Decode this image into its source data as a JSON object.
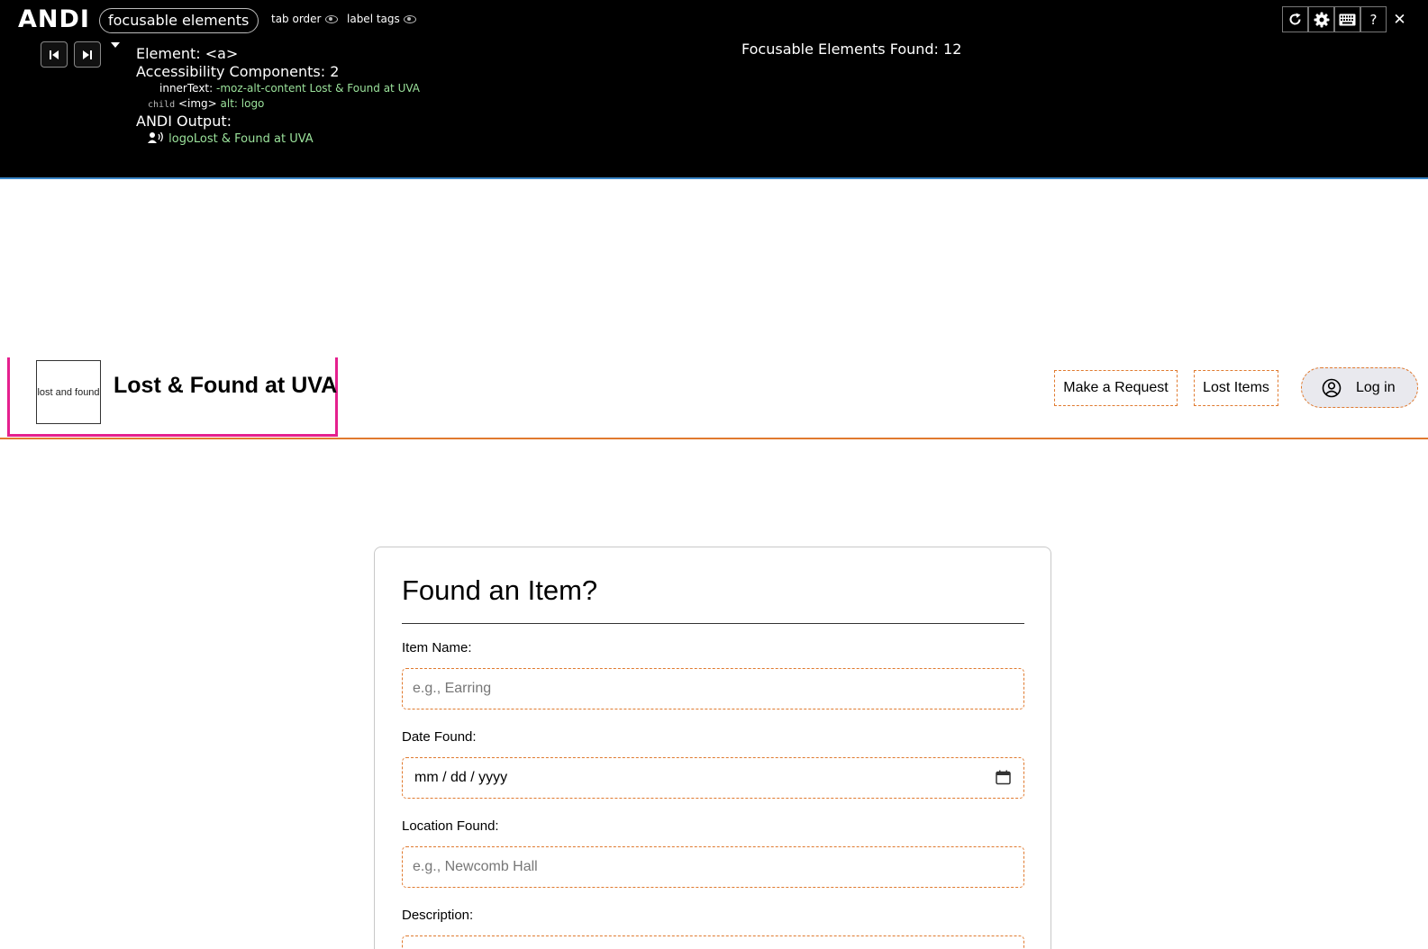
{
  "andi": {
    "logo": "ANDI",
    "mode": "focusable elements",
    "toggles": {
      "tab_order": "tab order",
      "label_tags": "label tags"
    },
    "element_line": "Element: <a>",
    "components_line": "Accessibility Components: 2",
    "inner_text_label": "innerText:",
    "inner_text_value": "-moz-alt-content Lost & Found at UVA",
    "child_label": "child",
    "child_tag": "<img>",
    "child_attr": "alt: logo",
    "output_label": "ANDI Output:",
    "output_part1": "logo",
    "output_part2": "Lost & Found at UVA",
    "found_text": "Focusable Elements Found: 12",
    "tool_icons": [
      "refresh-icon",
      "gear-icon",
      "keyboard-icon",
      "help-icon",
      "close-icon"
    ],
    "help_glyph": "?",
    "close_glyph": "✕"
  },
  "header": {
    "logo_text": "lost and found",
    "title": "Lost & Found at UVA",
    "nav": {
      "make_request": "Make a Request",
      "lost_items": "Lost Items"
    },
    "login": "Log in"
  },
  "form": {
    "title": "Found an Item?",
    "item_name_label": "Item Name:",
    "item_name_placeholder": "e.g., Earring",
    "date_label": "Date Found:",
    "date_value": "mm / dd / yyyy",
    "location_label": "Location Found:",
    "location_placeholder": "e.g., Newcomb Hall",
    "description_label": "Description:"
  },
  "colors": {
    "andi_bg": "#000000",
    "focus_highlight": "#e5208e",
    "dashed_outline": "#e07a2f",
    "header_rule": "#e07a2f",
    "andi_green": "#9be29b"
  }
}
